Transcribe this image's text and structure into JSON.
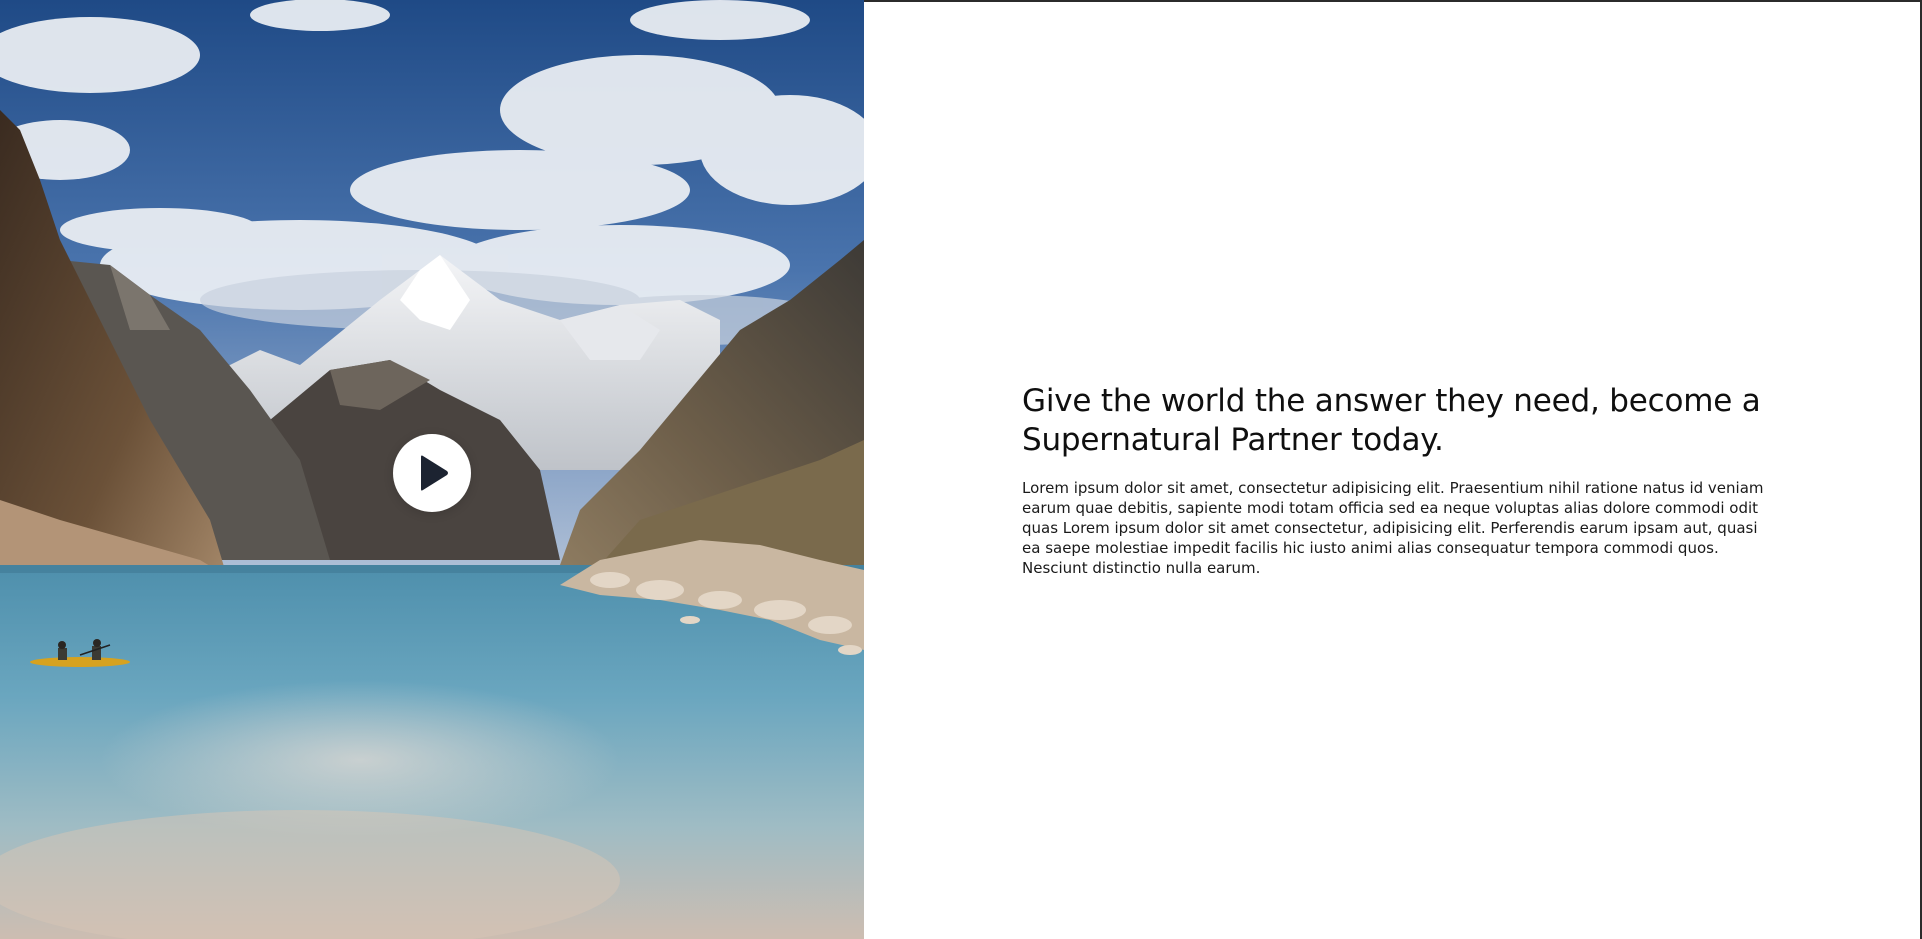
{
  "hero": {
    "image_subject": "mountain-lake-kayak-photo",
    "play_icon": "play-icon"
  },
  "content": {
    "headline": "Give the world the answer they need, become a Supernatural Partner today.",
    "body": "Lorem ipsum dolor sit amet, consectetur adipisicing elit. Praesentium nihil ratione natus id veniam earum quae debitis, sapiente modi totam officia sed ea neque voluptas alias dolore commodi odit quas Lorem ipsum dolor sit amet consectetur, adipisicing elit. Perferendis earum ipsam aut, quasi ea saepe molestiae impedit facilis hic iusto animi alias consequatur tempora commodi quos. Nesciunt distinctio nulla earum."
  },
  "colors": {
    "sky": "#2f5a9a",
    "water": "#6fa6bd",
    "play_button_bg": "#ffffff",
    "play_icon": "#1c2331",
    "text": "#0f0f0f"
  }
}
